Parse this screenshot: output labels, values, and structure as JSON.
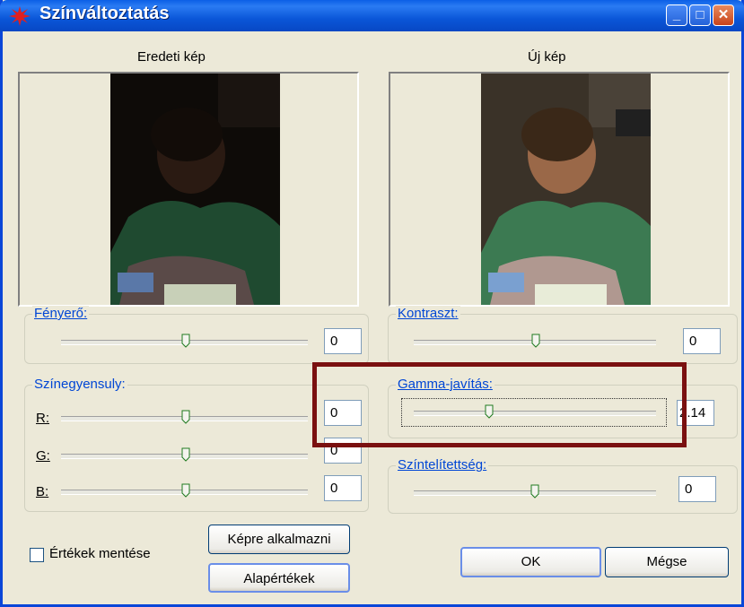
{
  "window": {
    "title": "Színváltoztatás",
    "icon": "color-flower-icon"
  },
  "titlebar_buttons": {
    "minimize_icon": "minimize-icon",
    "maximize_icon": "maximize-icon",
    "close_icon": "close-icon"
  },
  "previews": {
    "original_label": "Eredeti kép",
    "new_label": "Új kép"
  },
  "brightness": {
    "label": "Fényerő:",
    "value": "0"
  },
  "contrast": {
    "label": "Kontraszt:",
    "value": "0"
  },
  "color_balance": {
    "label": "Színegyensuly:",
    "channels": [
      {
        "label": "R:",
        "value": "0"
      },
      {
        "label": "G:",
        "value": "0"
      },
      {
        "label": "B:",
        "value": "0"
      }
    ]
  },
  "gamma": {
    "label": "Gamma-javítás:",
    "value": "2.14"
  },
  "saturation": {
    "label": "Színtelítettség:",
    "value": "0"
  },
  "save_values": {
    "label": "Értékek mentése",
    "checked": false
  },
  "buttons": {
    "apply": "Képre alkalmazni",
    "defaults": "Alapértékek",
    "ok": "OK",
    "cancel": "Mégse"
  },
  "colors": {
    "title_bar": "#0a56d8",
    "dialog_bg": "#ece9d8",
    "group_title": "#0046d5",
    "highlight_box": "#7a1010"
  }
}
